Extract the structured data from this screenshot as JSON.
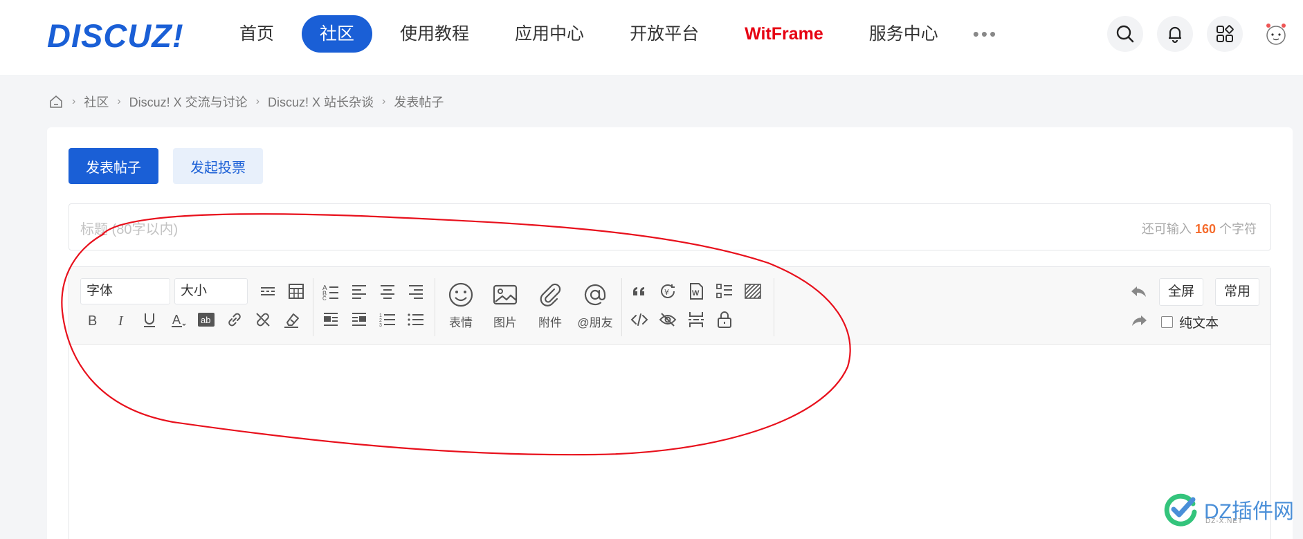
{
  "header": {
    "logo": "DISCUZ!",
    "nav": [
      "首页",
      "社区",
      "使用教程",
      "应用中心",
      "开放平台",
      "WitFrame",
      "服务中心"
    ],
    "more": "•••"
  },
  "breadcrumb": [
    "社区",
    "Discuz! X 交流与讨论",
    "Discuz! X 站长杂谈",
    "发表帖子"
  ],
  "actions": {
    "post": "发表帖子",
    "poll": "发起投票"
  },
  "title": {
    "placeholder": "标题 (80字以内)",
    "counter_prefix": "还可输入",
    "counter_value": "160",
    "counter_suffix": "个字符"
  },
  "editor": {
    "font": "字体",
    "size": "大小",
    "emoji": "表情",
    "image": "图片",
    "attach": "附件",
    "mention": "@朋友",
    "fullscreen": "全屏",
    "common": "常用",
    "plain_text": "纯文本"
  },
  "watermark": {
    "text": "DZ插件网",
    "sub": "DZ-X.NET"
  },
  "colors": {
    "brand": "#1a5fd6",
    "accent_red": "#e60012",
    "counter": "#f56c2d",
    "annotation": "#e8101c"
  }
}
